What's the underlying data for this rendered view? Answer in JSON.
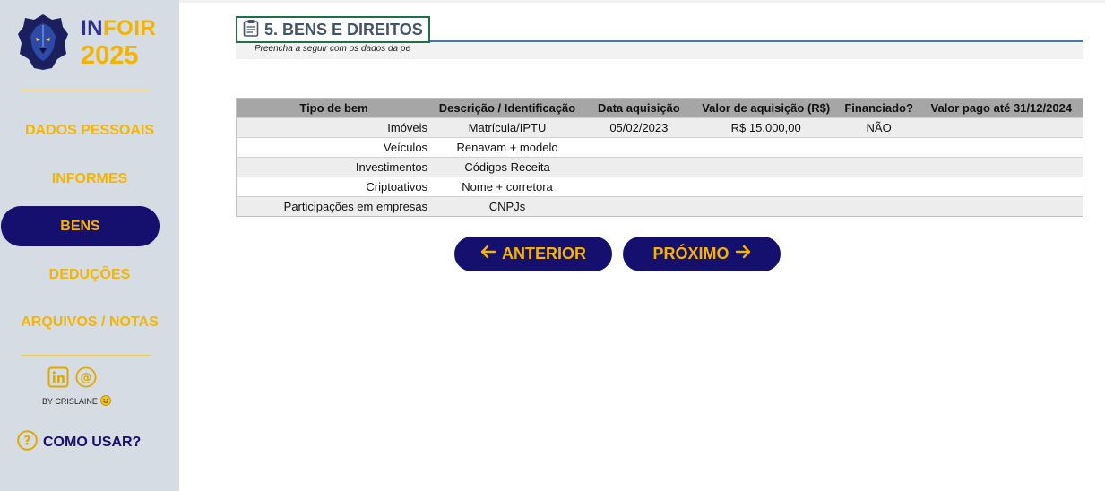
{
  "brand": {
    "name_first": "IN",
    "name_rest": "FOIR",
    "year": "2025"
  },
  "sidebar": {
    "items": [
      {
        "label": "DADOS PESSOAIS",
        "active": false
      },
      {
        "label": "INFORMES",
        "active": false
      },
      {
        "label": "BENS",
        "active": true
      },
      {
        "label": "DEDUÇÕES",
        "active": false
      },
      {
        "label": "ARQUIVOS / NOTAS",
        "active": false
      }
    ],
    "byline": "BY CRISLAINE",
    "help_label": "COMO USAR?"
  },
  "page": {
    "title": "5. BENS E DIREITOS",
    "subtitle": "Preencha a seguir com os dados da pe"
  },
  "table": {
    "headers": [
      "Tipo de bem",
      "Descrição / Identificação",
      "Data aquisição",
      "Valor de aquisição (R$)",
      "Financiado?",
      "Valor pago até 31/12/2024"
    ],
    "rows": [
      [
        "Imóveis",
        "Matrícula/IPTU",
        "05/02/2023",
        "R$ 15.000,00",
        "NÃO",
        ""
      ],
      [
        "Veículos",
        "Renavam + modelo",
        "",
        "",
        "",
        ""
      ],
      [
        "Investimentos",
        "Códigos Receita",
        "",
        "",
        "",
        ""
      ],
      [
        "Criptoativos",
        "Nome + corretora",
        "",
        "",
        "",
        ""
      ],
      [
        "Participações em empresas",
        "CNPJs",
        "",
        "",
        "",
        ""
      ]
    ]
  },
  "buttons": {
    "prev_label": "ANTERIOR",
    "next_label": "PRÓXIMO"
  },
  "colors": {
    "navy": "#150f6e",
    "gold": "#f5b400",
    "sidebar_bg": "#d6dce4",
    "header_gray": "#a6a6a6",
    "accent_blue": "#4472c4"
  },
  "icons": {
    "logo": "lion-head-icon",
    "title": "clipboard-icon",
    "linkedin": "linkedin-icon",
    "email": "at-sign-icon",
    "smile": "smiley-icon",
    "help": "question-circle-icon",
    "prev": "arrow-left-icon",
    "next": "arrow-right-icon"
  }
}
